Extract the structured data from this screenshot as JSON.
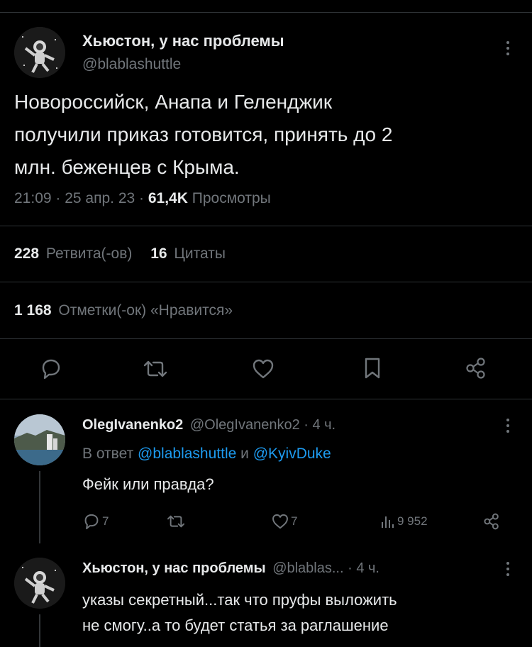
{
  "main_tweet": {
    "author_name": "Хьюстон, у нас проблемы",
    "handle": "@blablashuttle",
    "text_lines": [
      "Новороссийск, Анапа и Геленджик",
      "получили приказ готовится, принять до 2",
      "млн. беженцев с Крыма."
    ],
    "time": "21:09",
    "sep1": " · ",
    "date": "25 апр. 23",
    "sep2": " · ",
    "views_count": "61,4K",
    "views_label": " Просмотры",
    "retweets_count": "228",
    "retweets_label": "Ретвита(-ов)",
    "quotes_count": "16",
    "quotes_label": "Цитаты",
    "likes_count": "1 168",
    "likes_label": "Отметки(-ок) «Нравится»"
  },
  "reply1": {
    "author_name": "OlegIvanenko2",
    "handle": "@OlegIvanenko2",
    "time": " · 4 ч.",
    "reply_prefix": "В ответ ",
    "mention1": "@blablashuttle",
    "mention_and": " и ",
    "mention2": "@KyivDuke",
    "text": "Фейк или правда?",
    "reply_count": "7",
    "like_count": "7",
    "views_count": "9 952"
  },
  "reply2": {
    "author_name": "Хьюстон, у нас проблемы",
    "handle": "@blablas...",
    "time": " · 4 ч.",
    "text_lines": [
      "указы секретный...так что пруфы выложить",
      "не смогу..а то будет статья за раглашение"
    ]
  }
}
